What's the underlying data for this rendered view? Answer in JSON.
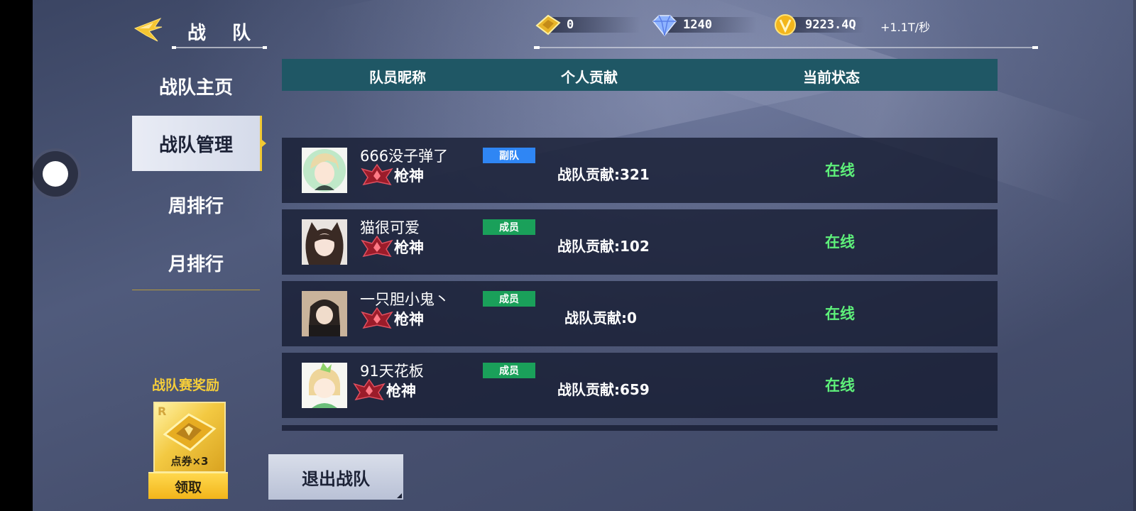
{
  "header": {
    "title": "战 队",
    "resources": [
      {
        "name": "coupon",
        "value": "0"
      },
      {
        "name": "diamond",
        "value": "1240"
      },
      {
        "name": "coin",
        "value": "9223.4Q"
      }
    ],
    "rate": "+1.1T/秒"
  },
  "sidebar": {
    "items": [
      {
        "label": "战队主页",
        "active": false
      },
      {
        "label": "战队管理",
        "active": true
      },
      {
        "label": "周排行",
        "active": false
      },
      {
        "label": "月排行",
        "active": false
      }
    ]
  },
  "reward": {
    "title": "战队赛奖励",
    "card_grade": "R",
    "item_label": "点券×3",
    "claim_label": "领取"
  },
  "table": {
    "headers": [
      "队员昵称",
      "个人贡献",
      "当前状态"
    ],
    "rows": [
      {
        "nickname": "666没子弹了",
        "rank": "枪神",
        "role": "副队",
        "contribution": "战队贡献:321",
        "status": "在线"
      },
      {
        "nickname": "猫很可爱",
        "rank": "枪神",
        "role": "成员",
        "contribution": "战队贡献:102",
        "status": "在线"
      },
      {
        "nickname": "一只胆小鬼丶",
        "rank": "枪神",
        "role": "成员",
        "contribution": "战队贡献:0",
        "status": "在线"
      },
      {
        "nickname": "91天花板",
        "rank": "枪神",
        "role": "成员",
        "contribution": "战队贡献:659",
        "status": "在线"
      }
    ]
  },
  "footer": {
    "exit_label": "退出战队"
  },
  "colors": {
    "accent_gold": "#f5cd3a",
    "online_green": "#5ef07a",
    "vice_badge": "#2f86f4",
    "member_badge": "#1aa05a",
    "header_bar": "#1f5765"
  },
  "icons": [
    "back-arrow-icon",
    "coupon-icon",
    "diamond-icon",
    "coin-icon",
    "rank-emblem-icon"
  ]
}
